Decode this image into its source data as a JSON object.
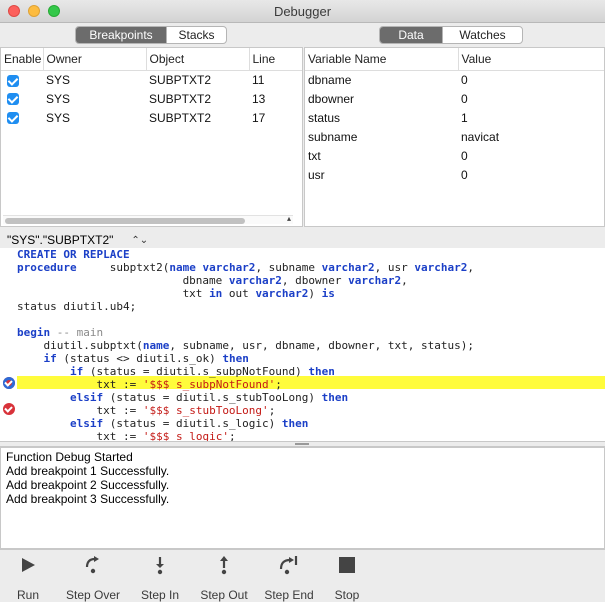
{
  "window": {
    "title": "Debugger"
  },
  "left_tabs": {
    "tabs": [
      "Breakpoints",
      "Stacks"
    ],
    "selected": "Breakpoints"
  },
  "right_tabs": {
    "tabs": [
      "Data",
      "Watches"
    ],
    "selected": "Data"
  },
  "breakpoints": {
    "columns": [
      "Enable",
      "Owner",
      "Object",
      "Line"
    ],
    "rows": [
      {
        "enabled": true,
        "owner": "SYS",
        "object": "SUBPTXT2",
        "line": "11"
      },
      {
        "enabled": true,
        "owner": "SYS",
        "object": "SUBPTXT2",
        "line": "13"
      },
      {
        "enabled": true,
        "owner": "SYS",
        "object": "SUBPTXT2",
        "line": "17"
      }
    ]
  },
  "variables": {
    "columns": [
      "Variable Name",
      "Value"
    ],
    "rows": [
      {
        "name": "dbname",
        "value": "0"
      },
      {
        "name": "dbowner",
        "value": "0"
      },
      {
        "name": "status",
        "value": "1"
      },
      {
        "name": "subname",
        "value": "navicat"
      },
      {
        "name": "txt",
        "value": "0"
      },
      {
        "name": "usr",
        "value": "0"
      }
    ]
  },
  "object_selector": {
    "value": "\"SYS\".\"SUBPTXT2\""
  },
  "code": {
    "line1": "CREATE OR REPLACE",
    "line2_kw": "procedure",
    "line2_rest": "     subptxt2(",
    "line2_a": "name",
    "line2_b": " varchar2",
    "line2_c": ", subname ",
    "line2_d": "varchar2",
    "line2_e": ", usr ",
    "line2_f": "varchar2",
    "line2_g": ",",
    "line3_a": "                         dbname ",
    "line3_b": "varchar2",
    "line3_c": ", dbowner ",
    "line3_d": "varchar2",
    "line3_e": ",",
    "line4_a": "                         txt ",
    "line4_b": "in",
    "line4_c": " out ",
    "line4_d": "varchar2",
    "line4_e": ") ",
    "line4_f": "is",
    "line5": "status diutil.ub4;",
    "line7_a": "begin",
    "line7_b": " -- main",
    "line8_a": "    diutil.subptxt(",
    "line8_b": "name",
    "line8_c": ", subname, usr, dbname, dbowner, txt, status);",
    "line9_a": "    ",
    "line9_b": "if",
    "line9_c": " (status <> diutil.s_ok) ",
    "line9_d": "then",
    "line10_a": "        ",
    "line10_b": "if",
    "line10_c": " (status = diutil.s_subpNotFound) ",
    "line10_d": "then",
    "line11_a": "            txt := ",
    "line11_b": "'$$$ s_subpNotFound'",
    "line11_c": ";",
    "line12_a": "        ",
    "line12_b": "elsif",
    "line12_c": " (status = diutil.s_stubTooLong) ",
    "line12_d": "then",
    "line13_a": "            txt := ",
    "line13_b": "'$$$ s_stubTooLong'",
    "line13_c": ";",
    "line14_a": "        ",
    "line14_b": "elsif",
    "line14_c": " (status = diutil.s_logic) ",
    "line14_d": "then",
    "line15_a": "            txt := ",
    "line15_b": "'$$$ s_logic'",
    "line15_c": ";"
  },
  "log": [
    "Function Debug Started",
    "Add breakpoint 1 Successfully.",
    "Add breakpoint 2 Successfully.",
    "Add breakpoint 3 Successfully."
  ],
  "controls": {
    "run": "Run",
    "step_over": "Step Over",
    "step_in": "Step In",
    "step_out": "Step Out",
    "step_end": "Step End",
    "stop": "Stop"
  }
}
